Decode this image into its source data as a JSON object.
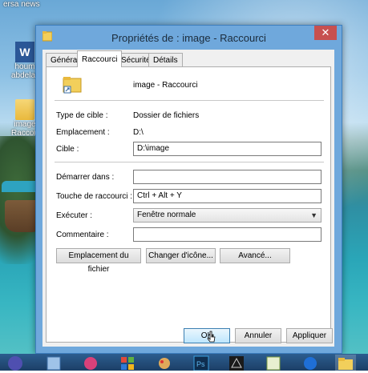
{
  "desktop": {
    "news_label": "ersa news",
    "icons": [
      {
        "label": "houm abdelaz"
      },
      {
        "label": "image Raccou"
      }
    ]
  },
  "window": {
    "title": "Propriétés de : image - Raccourci",
    "close_glyph": "✕",
    "tabs": [
      {
        "label": "Général",
        "active": false
      },
      {
        "label": "Raccourci",
        "active": true
      },
      {
        "label": "Sécurité",
        "active": false
      },
      {
        "label": "Détails",
        "active": false
      }
    ],
    "shortcut_name": "image - Raccourci",
    "fields": {
      "target_type_label": "Type de cible :",
      "target_type_value": "Dossier de fichiers",
      "location_label": "Emplacement :",
      "location_value": "D:\\",
      "target_label": "Cible :",
      "target_value": "D:\\image",
      "start_in_label": "Démarrer dans :",
      "start_in_value": "",
      "hotkey_label": "Touche de raccourci :",
      "hotkey_value": "Ctrl + Alt + Y",
      "run_label": "Exécuter :",
      "run_value": "Fenêtre normale",
      "comment_label": "Commentaire :",
      "comment_value": ""
    },
    "buttons": {
      "open_location": "Emplacement du fichier",
      "change_icon": "Changer d'icône...",
      "advanced": "Avancé...",
      "ok": "OK",
      "cancel": "Annuler",
      "apply": "Appliquer"
    }
  },
  "taskbar": {
    "items": [
      "browser-icon",
      "virtualbox-icon",
      "app-icon",
      "windows-store-icon",
      "paint-icon",
      "photoshop-icon",
      "3dsmax-icon",
      "notepadpp-icon",
      "teamviewer-icon",
      "file-explorer-icon"
    ]
  },
  "colors": {
    "window_frame": "#6fa8dc",
    "close_button": "#c7504f",
    "taskbar": "#1c3f66"
  }
}
